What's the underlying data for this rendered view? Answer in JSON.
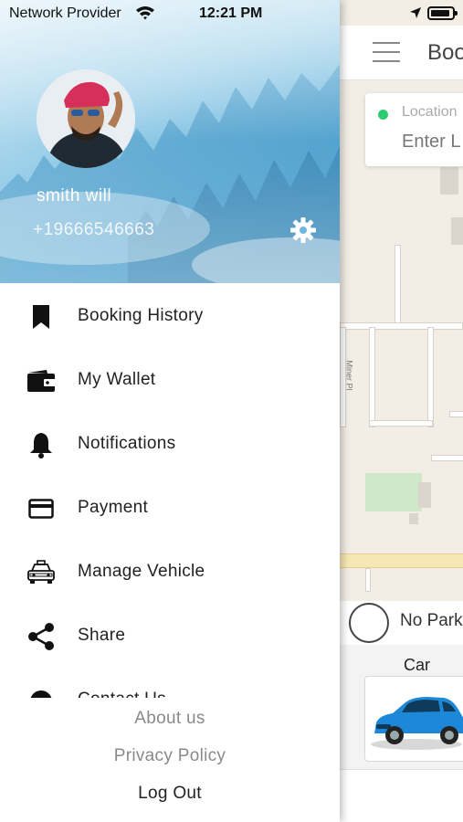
{
  "status_bar": {
    "carrier": "Network Provider",
    "time": "12:21 PM",
    "icons": [
      "wifi-icon",
      "location-arrow-icon",
      "battery-icon"
    ]
  },
  "profile": {
    "name": "smith will",
    "phone": "+19666546663",
    "settings_icon": "gear-icon"
  },
  "menu": {
    "items": [
      {
        "label": "Booking History",
        "icon": "bookmark-icon"
      },
      {
        "label": "My Wallet",
        "icon": "wallet-icon"
      },
      {
        "label": "Notifications",
        "icon": "bell-icon"
      },
      {
        "label": "Payment",
        "icon": "credit-card-icon"
      },
      {
        "label": "Manage Vehicle",
        "icon": "taxi-icon"
      },
      {
        "label": "Share",
        "icon": "share-icon"
      },
      {
        "label": "Contact Us",
        "icon": "contact-icon"
      }
    ]
  },
  "footer": {
    "about": "About us",
    "privacy": "Privacy Policy",
    "logout": "Log Out"
  },
  "background_screen": {
    "title": "Boo",
    "location_label": "Location",
    "location_placeholder": "Enter L",
    "street_label": "Miner Pl",
    "parking_option": "No Park",
    "vehicle_label": "Car"
  },
  "colors": {
    "header_sky": "#4aa6d4",
    "location_dot": "#2ecc71",
    "car_body": "#1e88d8"
  }
}
